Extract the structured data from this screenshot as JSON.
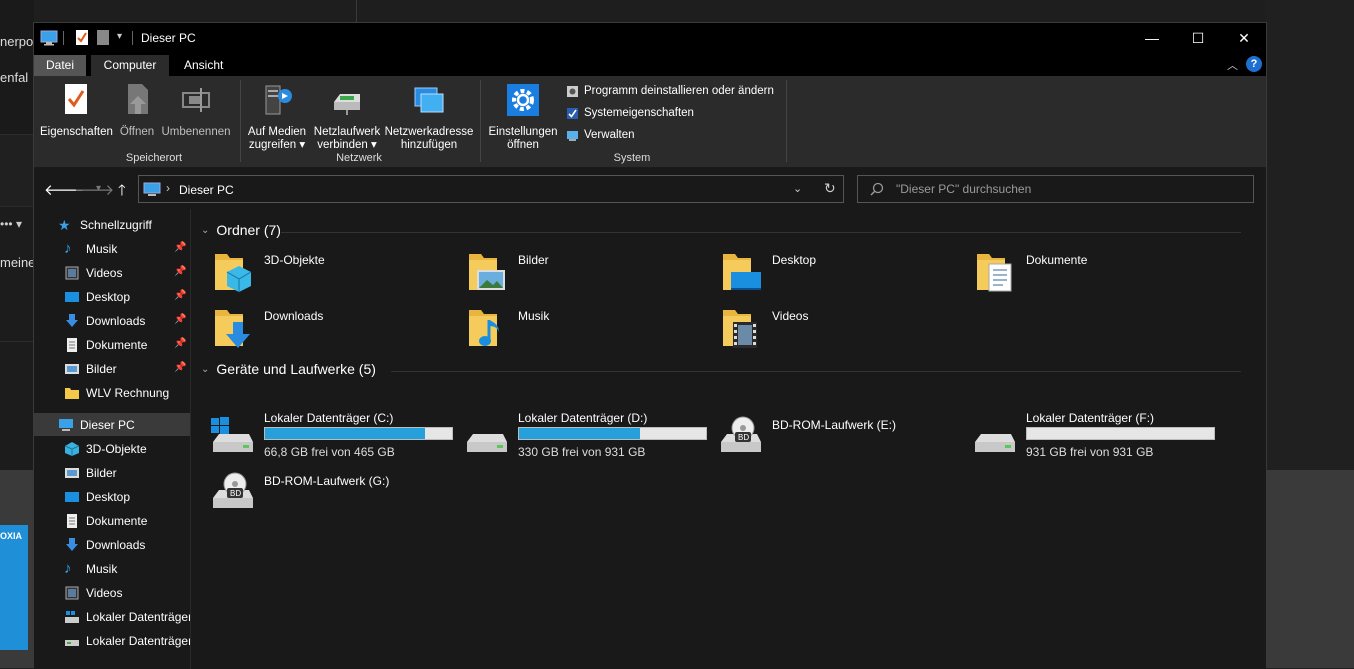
{
  "window": {
    "title": "Dieser PC",
    "controls": {
      "minimize": "—",
      "maximize": "☐",
      "close": "✕"
    }
  },
  "background_left_text": [
    "nerpo",
    "enfal",
    "meiner"
  ],
  "background_badge": "OXIA",
  "tabs": [
    {
      "label": "Datei"
    },
    {
      "label": "Computer"
    },
    {
      "label": "Ansicht"
    }
  ],
  "ribbon": {
    "buttons": {
      "properties": "Eigenschaften",
      "open": "Öffnen",
      "rename": "Umbenennen",
      "media_l1": "Auf Medien",
      "media_l2": "zugreifen",
      "netdrive_l1": "Netzlaufwerk",
      "netdrive_l2": "verbinden",
      "netaddr_l1": "Netzwerkadresse",
      "netaddr_l2": "hinzufügen",
      "settings_l1": "Einstellungen",
      "settings_l2": "öffnen",
      "uninstall": "Programm deinstallieren oder ändern",
      "sysprops": "Systemeigenschaften",
      "manage": "Verwalten"
    },
    "groups": {
      "location": "Speicherort",
      "network": "Netzwerk",
      "system": "System"
    }
  },
  "address": {
    "path": "Dieser PC",
    "search_placeholder": "\"Dieser PC\" durchsuchen"
  },
  "sidebar": {
    "quick_access": "Schnellzugriff",
    "quick_items": [
      "Musik",
      "Videos",
      "Desktop",
      "Downloads",
      "Dokumente",
      "Bilder",
      "WLV Rechnung"
    ],
    "this_pc": "Dieser PC",
    "pc_items": [
      "3D-Objekte",
      "Bilder",
      "Desktop",
      "Dokumente",
      "Downloads",
      "Musik",
      "Videos",
      "Lokaler Datenträger",
      "Lokaler Datenträger"
    ]
  },
  "content": {
    "folders_header": "Ordner (7)",
    "folders": [
      "3D-Objekte",
      "Bilder",
      "Desktop",
      "Dokumente",
      "Downloads",
      "Musik",
      "Videos"
    ],
    "drives_header": "Geräte und Laufwerke (5)",
    "drives": [
      {
        "name": "Lokaler Datenträger (C:)",
        "free": "66,8 GB frei von 465 GB",
        "used_fraction": 0.856
      },
      {
        "name": "Lokaler Datenträger (D:)",
        "free": "330 GB frei von 931 GB",
        "used_fraction": 0.646
      },
      {
        "name": "BD-ROM-Laufwerk (E:)",
        "free": ""
      },
      {
        "name": "Lokaler Datenträger (F:)",
        "free": "931 GB frei von 931 GB",
        "used_fraction": 0.0
      },
      {
        "name": "BD-ROM-Laufwerk (G:)",
        "free": ""
      }
    ]
  },
  "colors": {
    "accent": "#26a0da",
    "background": "#191919",
    "ribbon": "#2b2b2b",
    "folder": "#f5c84c"
  }
}
